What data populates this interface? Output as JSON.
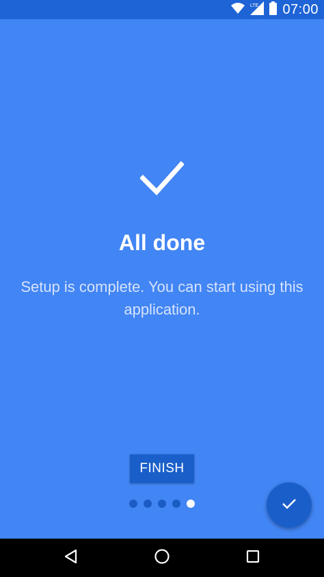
{
  "status_bar": {
    "time": "07:00",
    "network_label": "LTE",
    "icons": [
      "wifi-icon",
      "lte-signal-icon",
      "battery-icon"
    ]
  },
  "step": {
    "icon": "checkmark-icon",
    "title": "All done",
    "description": "Setup is complete. You can start using this application.",
    "finish_label": "FINISH"
  },
  "pager": {
    "total": 5,
    "current": 5
  },
  "fab": {
    "icon": "check-icon"
  },
  "nav_bar": {
    "buttons": [
      "back-icon",
      "home-icon",
      "recents-icon"
    ]
  },
  "colors": {
    "background": "#4285f4",
    "status_bar": "#1e64d6",
    "accent_dark": "#1a5fc9",
    "text_primary": "#ffffff",
    "text_secondary": "#d6e4fd"
  }
}
